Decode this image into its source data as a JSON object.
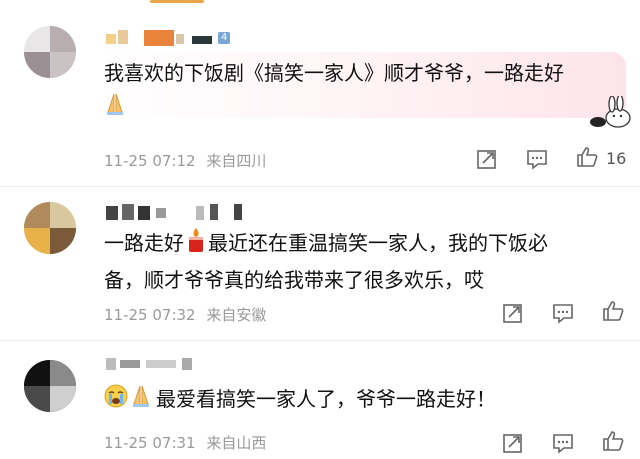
{
  "comments": [
    {
      "level": "4",
      "text": "我喜欢的下饭剧《搞笑一家人》顺才爷爷，一路走好",
      "emoji": "pray-emoji",
      "time": "11-25 07:12",
      "location": "来自四川",
      "likes": "16"
    },
    {
      "text_pre": "一路走好",
      "emoji": "candle-emoji",
      "text_post": "最近还在重温搞笑一家人，我的下饭必",
      "text_line2": "备，顺才爷爷真的给我带来了很多欢乐，哎",
      "time": "11-25 07:32",
      "location": "来自安徽"
    },
    {
      "emoji1": "crying-emoji",
      "emoji2": "pray-emoji",
      "text": "最爱看搞笑一家人了，爷爷一路走好！",
      "time": "11-25 07:31",
      "location": "来自山西"
    }
  ],
  "colors": {
    "text": "#111111",
    "meta": "#9a9a9a",
    "level_badge": "#7aa6d8",
    "bubble_pink": "#fde4ea"
  }
}
